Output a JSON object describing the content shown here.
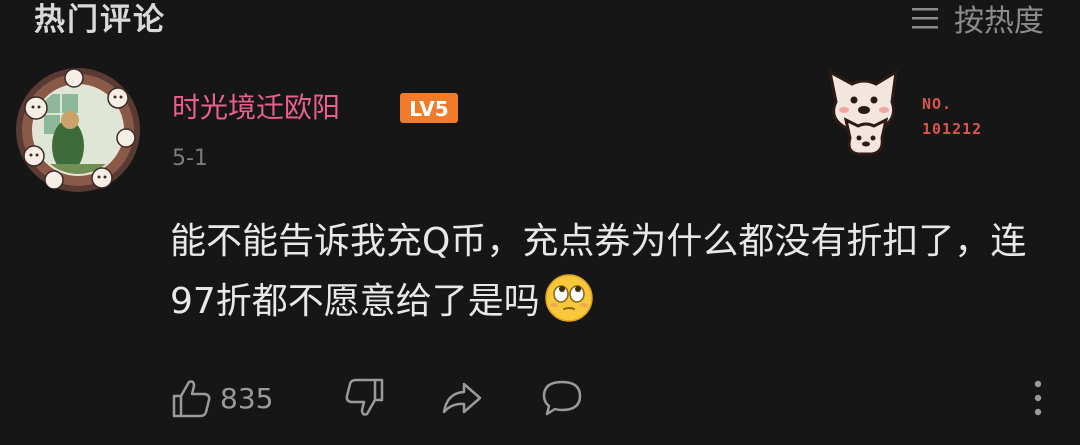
{
  "header": {
    "title": "热门评论",
    "sort_label": "按热度"
  },
  "comment": {
    "username": "时光境迁欧阳",
    "level": "LV5",
    "date": "5-1",
    "text": "能不能告诉我充Q币，充点券为什么都没有折扣了，连97折都不愿意给了是吗",
    "emoji": "rolling-eyes-emoji",
    "fan_badge": {
      "label": "NO.",
      "number": "101212"
    },
    "actions": {
      "like_count": "835"
    }
  },
  "colors": {
    "background": "#161616",
    "username": "#e9608e",
    "badge": "#d8564e",
    "level_badge": "#f07b2a"
  }
}
